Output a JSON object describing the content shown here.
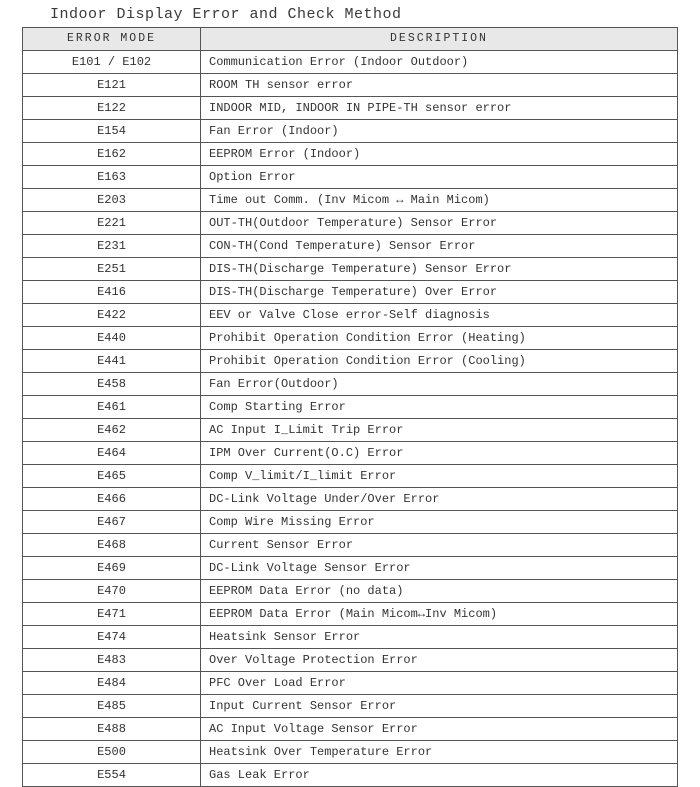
{
  "title": "Indoor Display Error and Check Method",
  "headers": {
    "code": "ERROR MODE",
    "description": "DESCRIPTION"
  },
  "rows": [
    {
      "code": "E101 / E102",
      "description": "Communication Error (Indoor Outdoor)"
    },
    {
      "code": "E121",
      "description": "ROOM TH sensor error"
    },
    {
      "code": "E122",
      "description": "INDOOR MID, INDOOR IN PIPE-TH sensor error"
    },
    {
      "code": "E154",
      "description": "Fan Error (Indoor)"
    },
    {
      "code": "E162",
      "description": "EEPROM Error (Indoor)"
    },
    {
      "code": "E163",
      "description": "Option Error"
    },
    {
      "code": "E203",
      "description": "Time out Comm. (Inv Micom ↔ Main Micom)"
    },
    {
      "code": "E221",
      "description": "OUT-TH(Outdoor Temperature) Sensor Error"
    },
    {
      "code": "E231",
      "description": "CON-TH(Cond Temperature) Sensor Error"
    },
    {
      "code": "E251",
      "description": "DIS-TH(Discharge Temperature) Sensor Error"
    },
    {
      "code": "E416",
      "description": "DIS-TH(Discharge Temperature) Over Error"
    },
    {
      "code": "E422",
      "description": "EEV or Valve Close error-Self diagnosis"
    },
    {
      "code": "E440",
      "description": "Prohibit Operation Condition Error (Heating)"
    },
    {
      "code": "E441",
      "description": "Prohibit Operation Condition Error (Cooling)"
    },
    {
      "code": "E458",
      "description": " Fan Error(Outdoor)"
    },
    {
      "code": "E461",
      "description": "Comp Starting Error"
    },
    {
      "code": "E462",
      "description": "AC Input I_Limit Trip Error"
    },
    {
      "code": "E464",
      "description": "IPM Over Current(O.C) Error"
    },
    {
      "code": "E465",
      "description": "Comp V_limit/I_limit Error"
    },
    {
      "code": "E466",
      "description": "DC-Link Voltage Under/Over Error"
    },
    {
      "code": "E467",
      "description": "Comp Wire Missing Error"
    },
    {
      "code": "E468",
      "description": "Current Sensor Error"
    },
    {
      "code": "E469",
      "description": "DC-Link Voltage Sensor Error"
    },
    {
      "code": "E470",
      "description": "EEPROM Data Error (no data)"
    },
    {
      "code": "E471",
      "description": "EEPROM Data Error (Main Micom↔Inv Micom)"
    },
    {
      "code": "E474",
      "description": "Heatsink Sensor Error"
    },
    {
      "code": "E483",
      "description": "Over Voltage Protection Error"
    },
    {
      "code": "E484",
      "description": "PFC Over Load Error"
    },
    {
      "code": "E485",
      "description": "Input Current Sensor Error"
    },
    {
      "code": "E488",
      "description": "AC Input Voltage Sensor Error"
    },
    {
      "code": "E500",
      "description": "Heatsink Over Temperature Error"
    },
    {
      "code": "E554",
      "description": "Gas Leak Error"
    }
  ]
}
